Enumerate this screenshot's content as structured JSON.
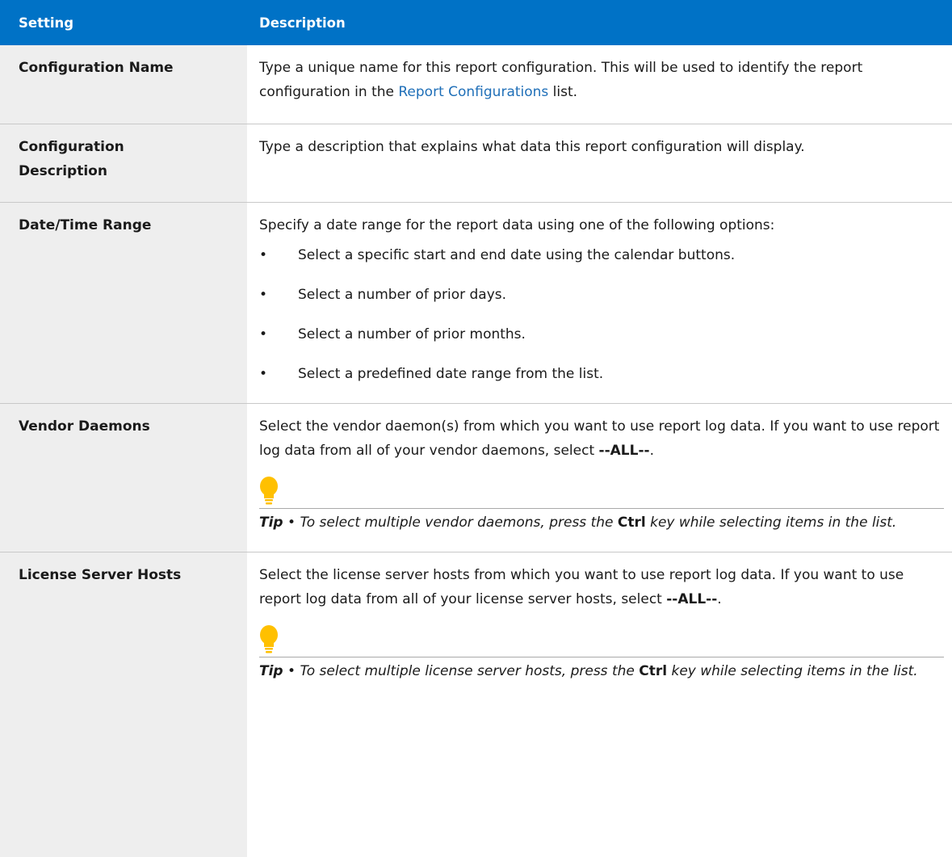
{
  "header": {
    "setting": "Setting",
    "description": "Description"
  },
  "rows": {
    "config_name": {
      "label": "Configuration Name",
      "text_before_link": "Type a unique name for this report configuration. This will be used to identify the report configuration in the ",
      "link": "Report Configurations",
      "text_after_link": " list."
    },
    "config_description": {
      "label_line1": "Configuration",
      "label_line2": "Description",
      "text": "Type a description that explains what data this report configuration will display."
    },
    "date_range": {
      "label": "Date/Time Range",
      "intro": "Specify a date range for the report data using one of the following options:",
      "bullet": "•",
      "options": [
        "Select a specific start and end date using the calendar buttons.",
        "Select a number of prior days.",
        "Select a number of prior months.",
        "Select a predefined date range from the list."
      ]
    },
    "vendor_daemons": {
      "label": "Vendor Daemons",
      "text": "Select the vendor daemon(s) from which you want to use report log data. If you want to use report log data from all of your vendor daemons, select ",
      "all": "--ALL--",
      "end": ".",
      "tip_label": "Tip",
      "tip_sep": " • ",
      "tip_before": "To select multiple vendor daemons, press the ",
      "tip_key": "Ctrl",
      "tip_after": " key while selecting items in the list."
    },
    "license_server_hosts": {
      "label": "License Server Hosts",
      "text": "Select the license server hosts from which you want to use report log data. If you want to use report log data from all of your license server hosts, select ",
      "all": "--ALL--",
      "end": ".",
      "tip_label": "Tip",
      "tip_sep": " • ",
      "tip_before": "To select multiple license server hosts, press the ",
      "tip_key": "Ctrl",
      "tip_after": " key while selecting items in the list."
    }
  },
  "colors": {
    "header_bg": "#0072c6",
    "setting_bg": "#eeeeee",
    "link": "#1f6fb8",
    "tip_icon": "#ffc000"
  },
  "icons": {
    "tip": "lightbulb-icon"
  }
}
